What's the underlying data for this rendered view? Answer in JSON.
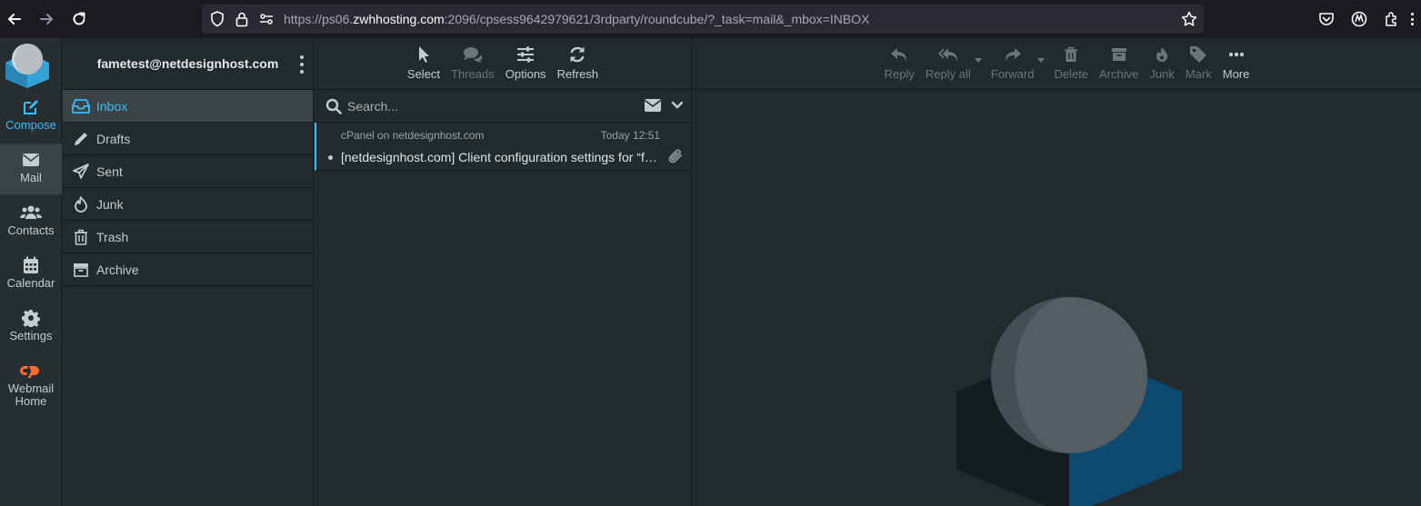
{
  "browser": {
    "url_prefix": "https://ps06.",
    "url_host": "zwhhosting.com",
    "url_rest": ":2096/cpsess9642979621/3rdparty/roundcube/?_task=mail&_mbox=INBOX"
  },
  "taskmenu": {
    "compose": "Compose",
    "mail": "Mail",
    "contacts": "Contacts",
    "calendar": "Calendar",
    "settings": "Settings",
    "webmail_home": "Webmail Home"
  },
  "account": {
    "email": "fametest@netdesignhost.com"
  },
  "folders": [
    {
      "label": "Inbox",
      "icon": "inbox-icon"
    },
    {
      "label": "Drafts",
      "icon": "pencil-icon"
    },
    {
      "label": "Sent",
      "icon": "paper-plane-icon"
    },
    {
      "label": "Junk",
      "icon": "fire-icon"
    },
    {
      "label": "Trash",
      "icon": "trash-icon"
    },
    {
      "label": "Archive",
      "icon": "archive-icon"
    }
  ],
  "list_toolbar": {
    "select": "Select",
    "threads": "Threads",
    "options": "Options",
    "refresh": "Refresh"
  },
  "search": {
    "placeholder": "Search..."
  },
  "messages": [
    {
      "from": "cPanel on netdesignhost.com",
      "date": "Today 12:51",
      "subject": "[netdesignhost.com] Client configuration settings for “fametest@netdesignhost.com”"
    }
  ],
  "message_toolbar": {
    "reply": "Reply",
    "reply_all": "Reply all",
    "forward": "Forward",
    "delete": "Delete",
    "archive": "Archive",
    "junk": "Junk",
    "mark": "Mark",
    "more": "More"
  },
  "colors": {
    "accent": "#37beff",
    "background": "#222a2d",
    "cpanel_orange": "#ff6c2c"
  }
}
